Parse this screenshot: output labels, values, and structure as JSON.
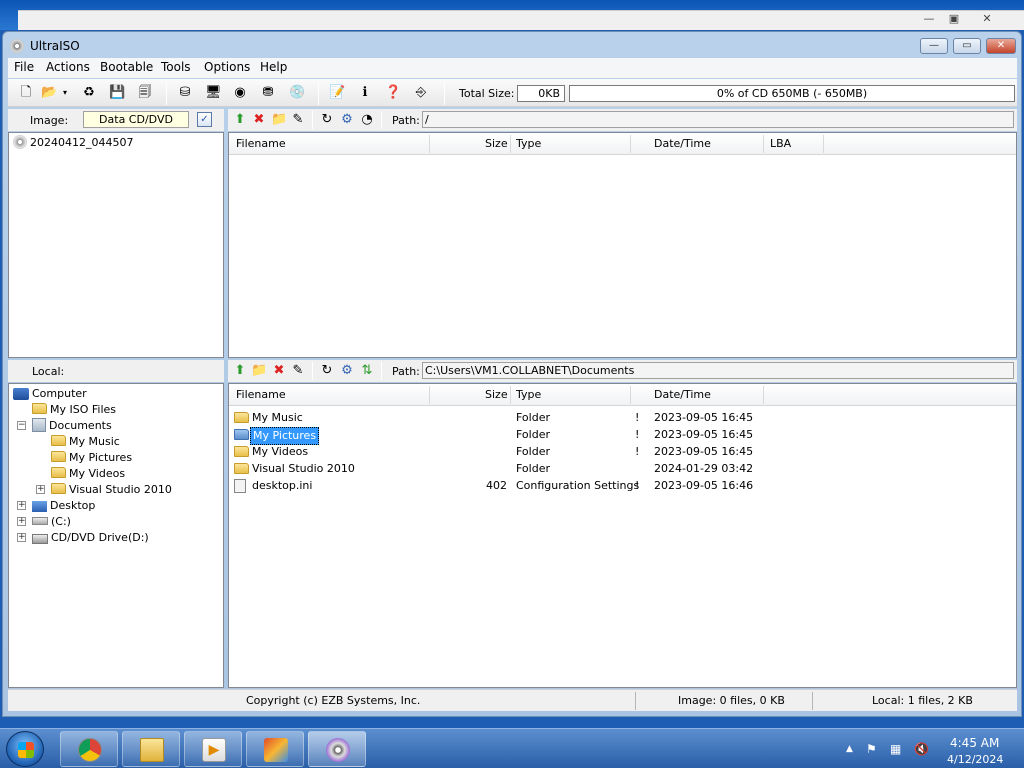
{
  "app": {
    "title": "UltraISO"
  },
  "menu": [
    "File",
    "Actions",
    "Bootable",
    "Tools",
    "Options",
    "Help"
  ],
  "toolbar": {
    "total_size_label": "Total Size:",
    "total_size_value": "0KB",
    "capacity_text": "0% of CD 650MB (- 650MB)",
    "capacity_percent": 0
  },
  "image_pane": {
    "label": "Image:",
    "type": "Data CD/DVD",
    "path_label": "Path:",
    "path": "/",
    "tree_root": "20240412_044507"
  },
  "image_columns": [
    "Filename",
    "Size",
    "Type",
    "Date/Time",
    "LBA"
  ],
  "local_pane": {
    "label": "Local:",
    "path_label": "Path:",
    "path": "C:\\Users\\VM1.COLLABNET\\Documents",
    "tree": [
      "Computer",
      "My ISO Files",
      "Documents",
      "My Music",
      "My Pictures",
      "My Videos",
      "Visual Studio 2010",
      "Desktop",
      "(C:)",
      "CD/DVD Drive(D:)"
    ],
    "columns": [
      "Filename",
      "Size",
      "Type",
      "Date/Time"
    ],
    "files": [
      {
        "name": "My Music",
        "size": "",
        "type": "Folder",
        "flag": "!",
        "date": "2023-09-05 16:45"
      },
      {
        "name": "My Pictures",
        "size": "",
        "type": "Folder",
        "flag": "!",
        "date": "2023-09-05 16:45"
      },
      {
        "name": "My Videos",
        "size": "",
        "type": "Folder",
        "flag": "!",
        "date": "2023-09-05 16:45"
      },
      {
        "name": "Visual Studio 2010",
        "size": "",
        "type": "Folder",
        "flag": "",
        "date": "2024-01-29 03:42"
      },
      {
        "name": "desktop.ini",
        "size": "402",
        "type": "Configuration Settings",
        "flag": "!",
        "date": "2023-09-05 16:46"
      }
    ]
  },
  "status": {
    "copyright": "Copyright (c) EZB Systems, Inc.",
    "image_info": "Image: 0 files, 0 KB",
    "local_info": "Local: 1 files, 2 KB"
  },
  "taskbar": {
    "time": "4:45 AM",
    "date": "4/12/2024"
  },
  "colors": {
    "accent": "#3399ff",
    "title_bg": "#b9d1ea"
  }
}
